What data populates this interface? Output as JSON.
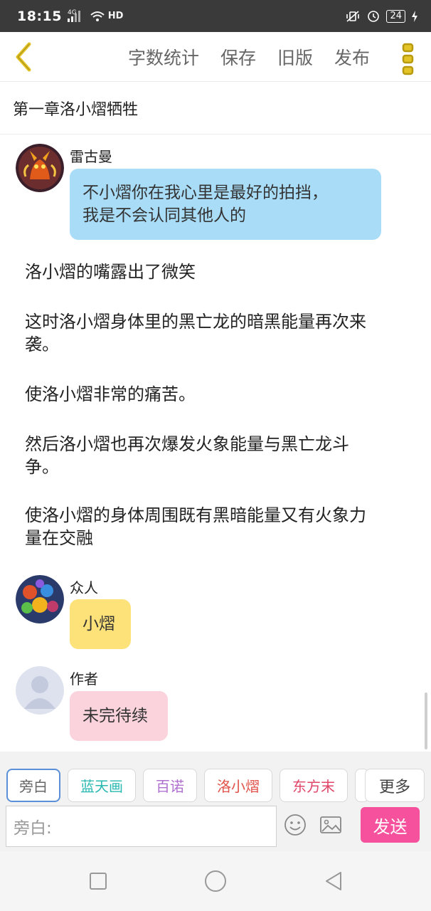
{
  "status_bar": {
    "time": "18:15",
    "network": "4G",
    "hd": "HD",
    "battery": "24"
  },
  "toolbar": {
    "back_icon": "chevron-left-icon",
    "actions": [
      "字数统计",
      "保存",
      "旧版",
      "发布"
    ],
    "menu_icon": "vertical-dots-icon",
    "accent_color": "#e3c325"
  },
  "chapter": {
    "title": "第一章洛小熠牺牲"
  },
  "messages": {
    "m1": {
      "speaker": "雷古曼",
      "lines": [
        "不小熠你在我心里是最好的拍挡，",
        "我是不会认同其他人的"
      ],
      "bubble_color": "#a9dcf7"
    },
    "narration": [
      [
        "洛小熠的嘴露出了微笑"
      ],
      [
        "这时洛小熠身体里的黑亡龙的暗黑能量再次来",
        "袭。"
      ],
      [
        "使洛小熠非常的痛苦。"
      ],
      [
        "然后洛小熠也再次爆发火象能量与黑亡龙斗",
        "争。"
      ],
      [
        "使洛小熠的身体周围既有黑暗能量又有火象力",
        "量在交融"
      ]
    ],
    "m2": {
      "speaker": "众人",
      "text": "小熠",
      "bubble_color": "#fde27a"
    },
    "m3": {
      "speaker": "作者",
      "text": "未完待续",
      "bubble_color": "#fbd3dc"
    }
  },
  "input_panel": {
    "roles": [
      {
        "label": "旁白",
        "color": "#666666"
      },
      {
        "label": "蓝天画",
        "color": "#29b8b0"
      },
      {
        "label": "百诺",
        "color": "#b070d0"
      },
      {
        "label": "洛小熠",
        "color": "#e0524a"
      },
      {
        "label": "东方末",
        "color": "#e0466a"
      }
    ],
    "more_label": "更多",
    "placeholder": "旁白:",
    "emoji_icon": "smiley-icon",
    "image_icon": "image-icon",
    "send_label": "发送",
    "send_color": "#f5519c"
  },
  "nav_bar": {
    "icons": [
      "recent-apps-icon",
      "home-icon",
      "back-triangle-icon"
    ]
  }
}
